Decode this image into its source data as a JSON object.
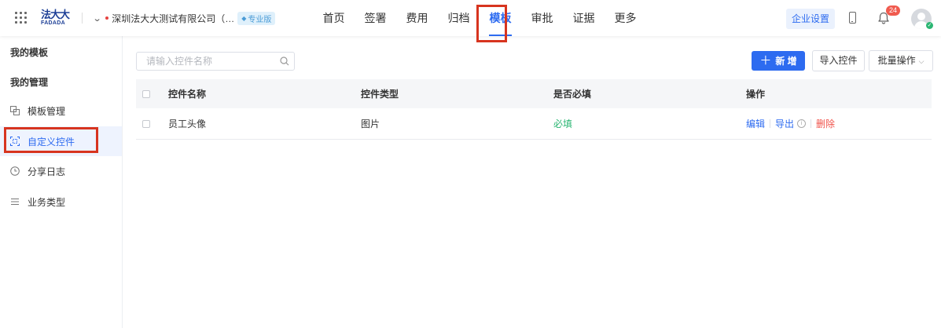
{
  "header": {
    "logo_cn": "法大大",
    "logo_en": "FADADA",
    "company_name": "深圳法大大测试有限公司（…",
    "plan_badge": "专业版",
    "nav": [
      {
        "label": "首页"
      },
      {
        "label": "签署"
      },
      {
        "label": "费用"
      },
      {
        "label": "归档"
      },
      {
        "label": "模板",
        "active": true
      },
      {
        "label": "审批"
      },
      {
        "label": "证据"
      },
      {
        "label": "更多"
      }
    ],
    "enterprise_settings": "企业设置",
    "notification_count": "24",
    "accent_color": "#2d6bf0"
  },
  "sidebar": {
    "section_templates": "我的模板",
    "section_manage": "我的管理",
    "items": [
      {
        "label": "模板管理",
        "icon": "template-icon"
      },
      {
        "label": "自定义控件",
        "icon": "custom-widget-icon",
        "active": true
      },
      {
        "label": "分享日志",
        "icon": "clock-icon"
      },
      {
        "label": "业务类型",
        "icon": "list-icon"
      }
    ]
  },
  "toolbar": {
    "search_placeholder": "请输入控件名称",
    "new_label": "新 增",
    "import_label": "导入控件",
    "batch_label": "批量操作"
  },
  "table": {
    "columns": [
      "控件名称",
      "控件类型",
      "是否必填",
      "操作"
    ],
    "rows": [
      {
        "name": "员工头像",
        "type": "图片",
        "required": "必填",
        "actions": {
          "edit": "编辑",
          "export": "导出",
          "delete": "删除"
        }
      }
    ]
  }
}
